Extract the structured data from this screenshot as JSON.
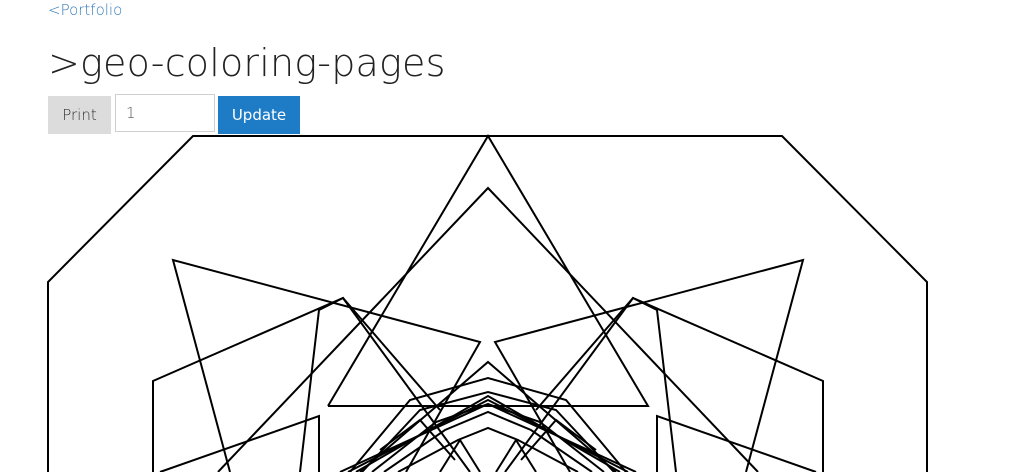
{
  "nav": {
    "back_link": "<Portfolio"
  },
  "header": {
    "title": ">geo-coloring-pages"
  },
  "toolbar": {
    "print_label": "Print",
    "seed_input_value": "1",
    "update_label": "Update"
  },
  "drawing": {
    "stroke_color": "#000000",
    "accent_color": "#1e7bc6"
  }
}
